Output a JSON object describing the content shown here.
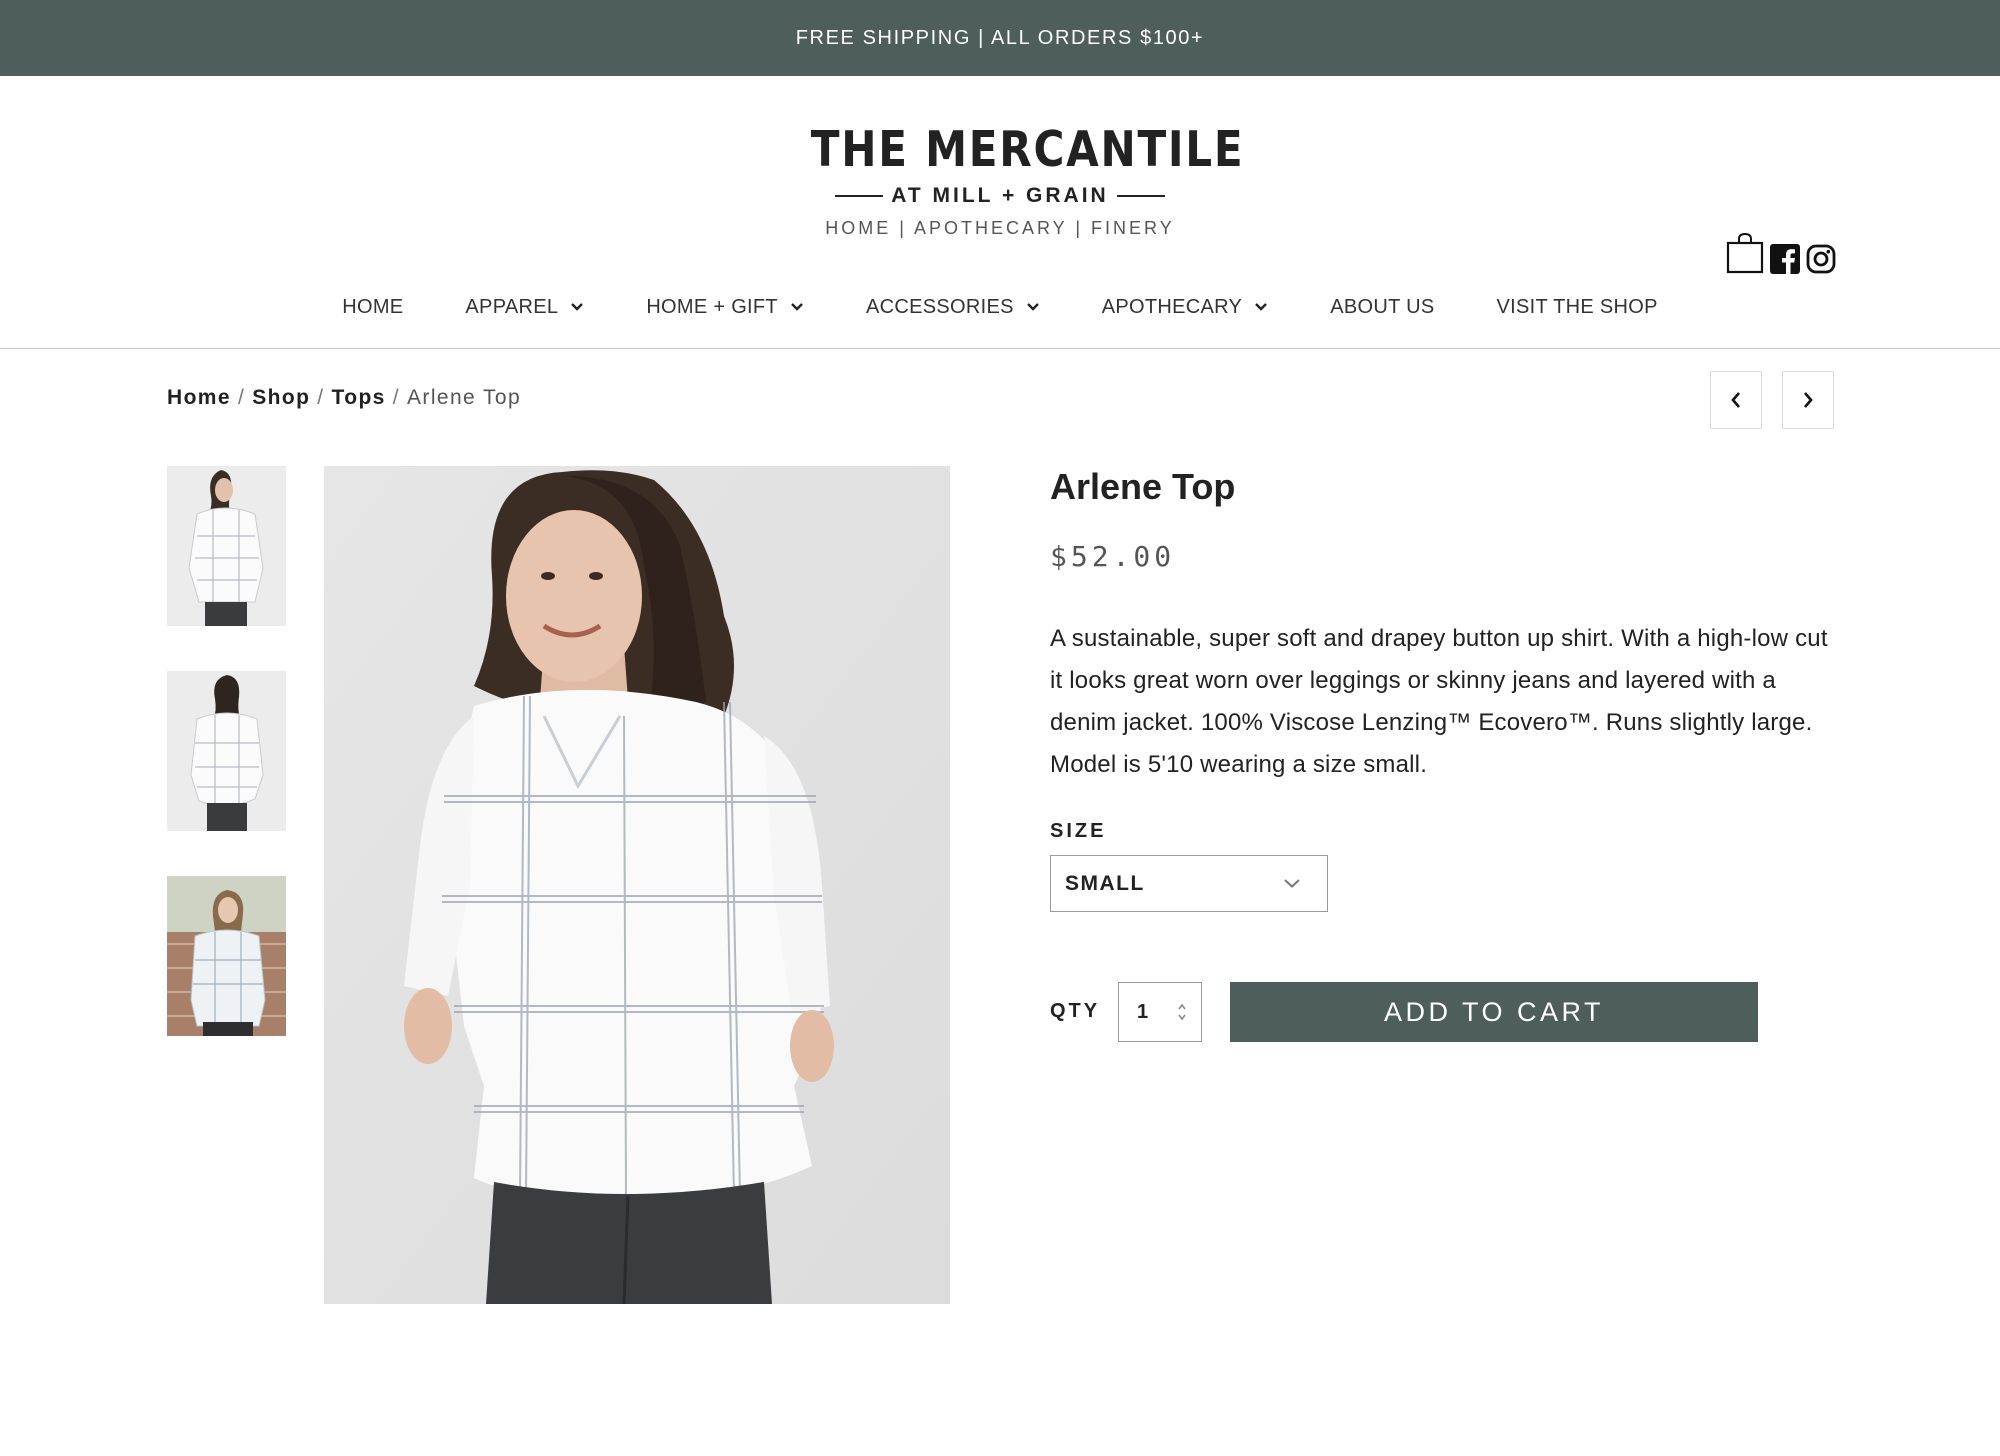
{
  "announcement": {
    "text": "FREE SHIPPING | ALL ORDERS $100+"
  },
  "logo": {
    "title": "THE MERCANTILE",
    "subtitle": "AT MILL + GRAIN",
    "tagline": "HOME | APOTHECARY | FINERY"
  },
  "header_icons": [
    "shopping-bag-icon",
    "facebook-icon",
    "instagram-icon"
  ],
  "nav": {
    "items": [
      {
        "label": "HOME",
        "dropdown": false
      },
      {
        "label": "APPAREL",
        "dropdown": true
      },
      {
        "label": "HOME + GIFT",
        "dropdown": true
      },
      {
        "label": "ACCESSORIES",
        "dropdown": true
      },
      {
        "label": "APOTHECARY",
        "dropdown": true
      },
      {
        "label": "ABOUT US",
        "dropdown": false
      },
      {
        "label": "VISIT THE SHOP",
        "dropdown": false
      }
    ]
  },
  "breadcrumb": {
    "items": [
      "Home",
      "Shop",
      "Tops"
    ],
    "current": "Arlene Top",
    "separator": "/"
  },
  "product": {
    "title": "Arlene Top",
    "price": "$52.00",
    "description": "A sustainable, super soft and drapey button up shirt. With a high-low cut it looks great worn over leggings or skinny jeans and layered with a denim jacket. 100% Viscose Lenzing™ Ecovero™. Runs slightly large. Model is 5'10 wearing a size small.",
    "size_label": "SIZE",
    "size_selected": "SMALL",
    "qty_label": "QTY",
    "qty_value": "1",
    "add_to_cart": "ADD TO CART"
  },
  "colors": {
    "brand": "#4e5e5c",
    "text": "#222222",
    "border": "#9a9a9a"
  }
}
